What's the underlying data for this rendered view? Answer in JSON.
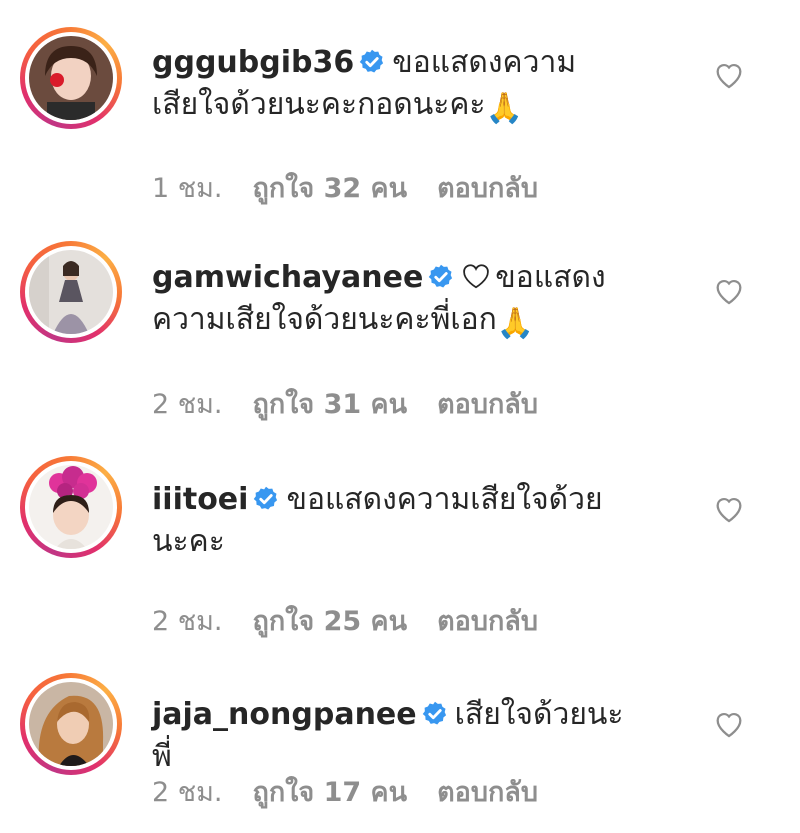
{
  "comments": [
    {
      "username": "gggubgib36",
      "text": "ขอแสดงความเสียใจด้วยนะคะกอดนะคะ",
      "emoji": "🙏",
      "time": "1 ชม.",
      "likes": "ถูกใจ 32 คน",
      "reply": "ตอบกลับ"
    },
    {
      "username": "gamwichayanee",
      "text": "ขอแสดงความเสียใจด้วยนะคะพี่เอก",
      "emoji": "🙏",
      "time": "2 ชม.",
      "likes": "ถูกใจ 31 คน",
      "reply": "ตอบกลับ"
    },
    {
      "username": "iiitoei",
      "text": "ขอแสดงความเสียใจด้วยนะคะ",
      "time": "2 ชม.",
      "likes": "ถูกใจ 25 คน",
      "reply": "ตอบกลับ"
    },
    {
      "username": "jaja_nongpanee",
      "text": "เสียใจด้วยนะพี่",
      "time": "2 ชม.",
      "likes": "ถูกใจ 17 คน",
      "reply": "ตอบกลับ"
    }
  ],
  "colors": {
    "verified": "#3897f0",
    "meta_text": "#8e8e8e",
    "body_text": "#262626"
  },
  "icons": {
    "verified": "verified-badge-icon",
    "like": "heart-outline-icon"
  }
}
